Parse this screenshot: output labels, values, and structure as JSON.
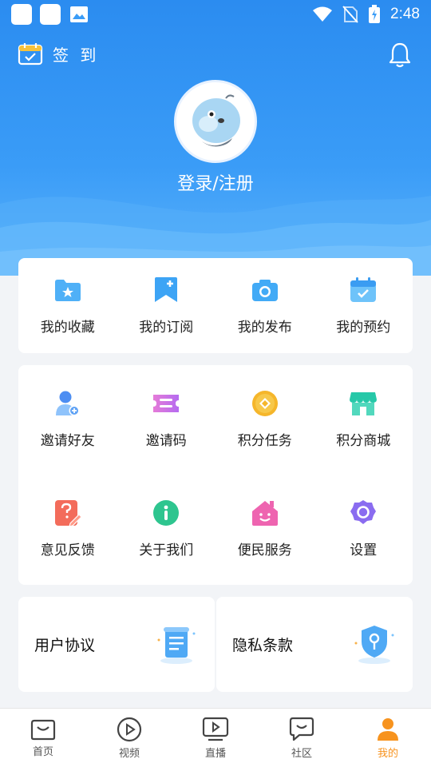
{
  "status": {
    "time": "2:48"
  },
  "header": {
    "signin_label": "签 到",
    "login_label": "登录/注册"
  },
  "shortcuts": [
    {
      "label": "我的收藏",
      "icon": "star-folder-icon"
    },
    {
      "label": "我的订阅",
      "icon": "subscribe-bookmark-icon"
    },
    {
      "label": "我的发布",
      "icon": "camera-icon"
    },
    {
      "label": "我的预约",
      "icon": "calendar-check-icon"
    }
  ],
  "services": [
    {
      "label": "邀请好友",
      "icon": "add-user-icon"
    },
    {
      "label": "邀请码",
      "icon": "ticket-icon"
    },
    {
      "label": "积分任务",
      "icon": "coin-icon"
    },
    {
      "label": "积分商城",
      "icon": "store-icon"
    },
    {
      "label": "意见反馈",
      "icon": "feedback-icon"
    },
    {
      "label": "关于我们",
      "icon": "info-icon"
    },
    {
      "label": "便民服务",
      "icon": "home-smile-icon"
    },
    {
      "label": "设置",
      "icon": "settings-icon"
    }
  ],
  "agreements": {
    "user_agreement": "用户协议",
    "privacy_policy": "隐私条款"
  },
  "tabs": [
    {
      "label": "首页",
      "icon": "home-bag-icon"
    },
    {
      "label": "视频",
      "icon": "play-circle-icon"
    },
    {
      "label": "直播",
      "icon": "tv-play-icon"
    },
    {
      "label": "社区",
      "icon": "chat-bubble-icon"
    },
    {
      "label": "我的",
      "icon": "person-icon"
    }
  ],
  "colors": {
    "primary": "#2b8cf0",
    "active_tab": "#f7931e"
  }
}
